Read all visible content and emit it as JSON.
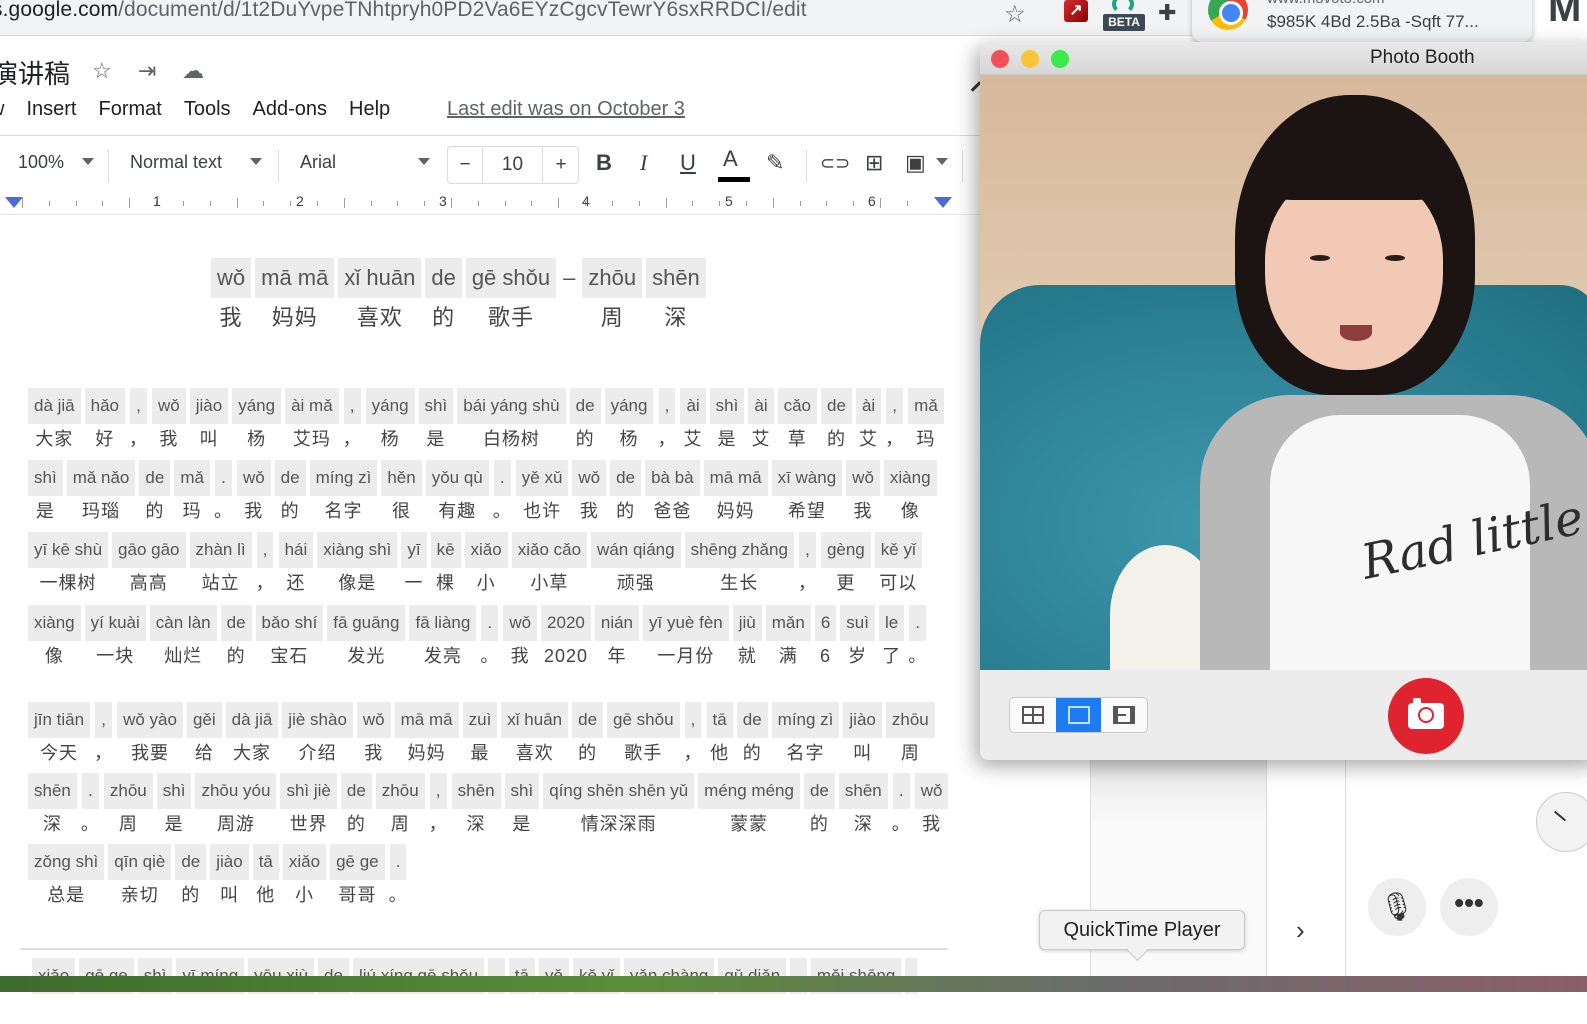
{
  "browser": {
    "url_host": "s.google.com",
    "url_path": "/document/d/1t2DuYvpeTNhtpryh0PD2Va6EYzCgcvTewrY6sxRRDCI/edit",
    "extension_badge": "BETA",
    "tab_card": {
      "url": "www.movoto.com",
      "title": "$985K 4Bd 2.5Ba -Sqft 77..."
    },
    "partial_tile_letter": "M",
    "icons": {
      "bookmark": "☆",
      "puzzle": "✚",
      "red_ext": "↗"
    }
  },
  "docs": {
    "title": "演讲稿",
    "title_icons": {
      "star": "☆",
      "move": "⇥",
      "cloud": "☁"
    },
    "menu": [
      "w",
      "Insert",
      "Format",
      "Tools",
      "Add-ons",
      "Help"
    ],
    "last_edit": "Last edit was on October 3",
    "toolbar": {
      "zoom": "100%",
      "style": "Normal text",
      "font": "Arial",
      "decrease": "−",
      "font_size": "10",
      "increase": "+",
      "bold": "B",
      "italic": "I",
      "underline": "U",
      "text_color": "A",
      "highlight": "✎",
      "link": "⊂⊃",
      "comment": "⊞",
      "image": "▣"
    },
    "ruler_numbers": [
      "1",
      "2",
      "3",
      "4",
      "5",
      "6"
    ]
  },
  "document": {
    "title_line": {
      "pairs": [
        {
          "py": "wǒ",
          "hz": "我"
        },
        {
          "py": "mā mā",
          "hz": "妈妈"
        },
        {
          "py": "xǐ huān",
          "hz": "喜欢"
        },
        {
          "py": "de",
          "hz": "的"
        },
        {
          "py": "gē shǒu",
          "hz": "歌手"
        }
      ],
      "dash": "–",
      "pairs2": [
        {
          "py": "zhōu",
          "hz": "周"
        },
        {
          "py": "shēn",
          "hz": "深"
        }
      ]
    },
    "lines": [
      [
        {
          "py": "dà jiā",
          "hz": "大家"
        },
        {
          "py": "hǎo",
          "hz": "好"
        },
        {
          "py": ",",
          "hz": "，"
        },
        {
          "py": "wǒ",
          "hz": "我"
        },
        {
          "py": "jiào",
          "hz": "叫"
        },
        {
          "py": "yáng",
          "hz": "杨"
        },
        {
          "py": "ài mǎ",
          "hz": "艾玛"
        },
        {
          "py": ",",
          "hz": "，"
        },
        {
          "py": "yáng",
          "hz": "杨"
        },
        {
          "py": "shì",
          "hz": "是"
        },
        {
          "py": "bái yáng shù",
          "hz": "白杨树"
        },
        {
          "py": "de",
          "hz": "的"
        },
        {
          "py": "yáng",
          "hz": "杨"
        },
        {
          "py": ",",
          "hz": "，"
        },
        {
          "py": "ài",
          "hz": "艾"
        },
        {
          "py": "shì",
          "hz": "是"
        },
        {
          "py": "ài",
          "hz": "艾"
        },
        {
          "py": "cǎo",
          "hz": "草"
        },
        {
          "py": "de",
          "hz": "的"
        },
        {
          "py": "ài",
          "hz": "艾"
        },
        {
          "py": ",",
          "hz": "，"
        },
        {
          "py": "mǎ",
          "hz": "玛"
        }
      ],
      [
        {
          "py": "shì",
          "hz": "是"
        },
        {
          "py": "mǎ nǎo",
          "hz": "玛瑙"
        },
        {
          "py": "de",
          "hz": "的"
        },
        {
          "py": "mǎ",
          "hz": "玛"
        },
        {
          "py": ".",
          "hz": "。"
        },
        {
          "py": "wǒ",
          "hz": "我"
        },
        {
          "py": "de",
          "hz": "的"
        },
        {
          "py": "míng zì",
          "hz": "名字"
        },
        {
          "py": "hěn",
          "hz": "很"
        },
        {
          "py": "yǒu qù",
          "hz": "有趣"
        },
        {
          "py": ".",
          "hz": "。"
        },
        {
          "py": "yě xǔ",
          "hz": "也许"
        },
        {
          "py": "wǒ",
          "hz": "我"
        },
        {
          "py": "de",
          "hz": "的"
        },
        {
          "py": "bà bà",
          "hz": "爸爸"
        },
        {
          "py": "mā mā",
          "hz": "妈妈"
        },
        {
          "py": "xī wàng",
          "hz": "希望"
        },
        {
          "py": "wǒ",
          "hz": "我"
        },
        {
          "py": "xiàng",
          "hz": "像"
        }
      ],
      [
        {
          "py": "yī kē shù",
          "hz": "一棵树"
        },
        {
          "py": "gāo gāo",
          "hz": "高高"
        },
        {
          "py": "zhàn lì",
          "hz": "站立"
        },
        {
          "py": ",",
          "hz": "，"
        },
        {
          "py": "hái",
          "hz": "还"
        },
        {
          "py": "xiàng shì",
          "hz": "像是"
        },
        {
          "py": "yī",
          "hz": "一"
        },
        {
          "py": "kē",
          "hz": "棵"
        },
        {
          "py": "xiǎo",
          "hz": "小"
        },
        {
          "py": "xiǎo cǎo",
          "hz": "小草"
        },
        {
          "py": "wán qiáng",
          "hz": "顽强"
        },
        {
          "py": "shēng zhǎng",
          "hz": "生长"
        },
        {
          "py": ",",
          "hz": "，"
        },
        {
          "py": "gèng",
          "hz": "更"
        },
        {
          "py": "kě yǐ",
          "hz": "可以"
        }
      ],
      [
        {
          "py": "xiàng",
          "hz": "像"
        },
        {
          "py": "yí kuài",
          "hz": "一块"
        },
        {
          "py": "càn làn",
          "hz": "灿烂"
        },
        {
          "py": "de",
          "hz": "的"
        },
        {
          "py": "bǎo shí",
          "hz": "宝石"
        },
        {
          "py": "fā guāng",
          "hz": "发光"
        },
        {
          "py": "fā liàng",
          "hz": "发亮"
        },
        {
          "py": ".",
          "hz": "。"
        },
        {
          "py": "wǒ",
          "hz": "我"
        },
        {
          "py": "2020",
          "hz": "2020"
        },
        {
          "py": "nián",
          "hz": "年"
        },
        {
          "py": "yī yuè fèn",
          "hz": "一月份"
        },
        {
          "py": "jiù",
          "hz": "就"
        },
        {
          "py": "mǎn",
          "hz": "满"
        },
        {
          "py": "6",
          "hz": "6"
        },
        {
          "py": "suì",
          "hz": "岁"
        },
        {
          "py": "le",
          "hz": "了"
        },
        {
          "py": ".",
          "hz": "。"
        }
      ],
      [
        {
          "py": "jīn tiān",
          "hz": "今天"
        },
        {
          "py": ",",
          "hz": "，"
        },
        {
          "py": "wǒ yào",
          "hz": "我要"
        },
        {
          "py": "gěi",
          "hz": "给"
        },
        {
          "py": "dà jiā",
          "hz": "大家"
        },
        {
          "py": "jiè shào",
          "hz": "介绍"
        },
        {
          "py": "wǒ",
          "hz": "我"
        },
        {
          "py": "mā mā",
          "hz": "妈妈"
        },
        {
          "py": "zuì",
          "hz": "最"
        },
        {
          "py": "xǐ huān",
          "hz": "喜欢"
        },
        {
          "py": "de",
          "hz": "的"
        },
        {
          "py": "gē shǒu",
          "hz": "歌手"
        },
        {
          "py": ",",
          "hz": "，"
        },
        {
          "py": "tā",
          "hz": "他"
        },
        {
          "py": "de",
          "hz": "的"
        },
        {
          "py": "míng zì",
          "hz": "名字"
        },
        {
          "py": "jiào",
          "hz": "叫"
        },
        {
          "py": "zhōu",
          "hz": "周"
        }
      ],
      [
        {
          "py": "shēn",
          "hz": "深"
        },
        {
          "py": ".",
          "hz": "。"
        },
        {
          "py": "zhōu",
          "hz": "周"
        },
        {
          "py": "shì",
          "hz": "是"
        },
        {
          "py": "zhōu yóu",
          "hz": "周游"
        },
        {
          "py": "shì jiè",
          "hz": "世界"
        },
        {
          "py": "de",
          "hz": "的"
        },
        {
          "py": "zhōu",
          "hz": "周"
        },
        {
          "py": ",",
          "hz": "，"
        },
        {
          "py": "shēn",
          "hz": "深"
        },
        {
          "py": "shì",
          "hz": "是"
        },
        {
          "py": "qíng shēn shēn yǔ",
          "hz": "情深深雨"
        },
        {
          "py": "méng méng",
          "hz": "蒙蒙"
        },
        {
          "py": "de",
          "hz": "的"
        },
        {
          "py": "shēn",
          "hz": "深"
        },
        {
          "py": ".",
          "hz": "。"
        },
        {
          "py": "wǒ",
          "hz": "我"
        }
      ],
      [
        {
          "py": "zǒng shì",
          "hz": "总是"
        },
        {
          "py": "qīn qiè",
          "hz": "亲切"
        },
        {
          "py": "de",
          "hz": "的"
        },
        {
          "py": "jiào",
          "hz": "叫"
        },
        {
          "py": "tā",
          "hz": "他"
        },
        {
          "py": "xiǎo",
          "hz": "小"
        },
        {
          "py": "gē ge",
          "hz": "哥哥"
        },
        {
          "py": ".",
          "hz": "。"
        }
      ],
      [
        {
          "py": "xiǎo",
          "hz": ""
        },
        {
          "py": "gē ge",
          "hz": ""
        },
        {
          "py": "shì",
          "hz": ""
        },
        {
          "py": "yī míng",
          "hz": ""
        },
        {
          "py": "yōu xiù",
          "hz": ""
        },
        {
          "py": "de",
          "hz": ""
        },
        {
          "py": "liú xíng gē shǒu",
          "hz": ""
        },
        {
          "py": ",",
          "hz": ""
        },
        {
          "py": "tā",
          "hz": ""
        },
        {
          "py": "yě",
          "hz": ""
        },
        {
          "py": "kě yǐ",
          "hz": ""
        },
        {
          "py": "yǎn chàng",
          "hz": ""
        },
        {
          "py": "gǔ diǎn",
          "hz": ""
        },
        {
          "py": ",",
          "hz": ""
        },
        {
          "py": "měi shēng",
          "hz": ""
        },
        {
          "py": "",
          "hz": ""
        }
      ]
    ]
  },
  "photo_booth": {
    "title": "Photo Booth",
    "traffic_colors": {
      "close": "#f25056",
      "minimize": "#fac536",
      "zoom": "#39ea49"
    },
    "view_modes": [
      "four-up",
      "single",
      "movie"
    ],
    "active_view": "single",
    "shirt_print": "Rad little",
    "shutter_color": "#e0242f"
  },
  "background_app": {
    "tooltip": "QuickTime Player",
    "chevron": "›",
    "mic": "🎙",
    "more": "•••"
  }
}
